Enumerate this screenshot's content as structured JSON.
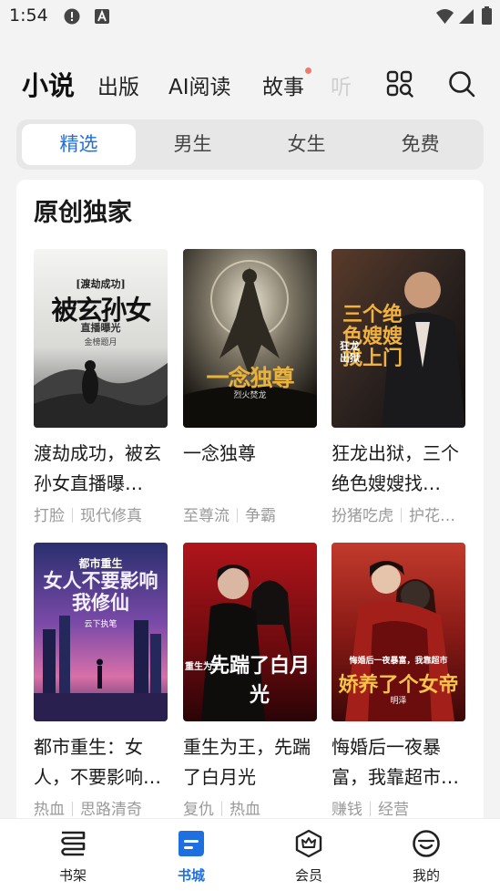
{
  "status": {
    "time": "1:54"
  },
  "top_nav": {
    "tabs": [
      {
        "label": "小说",
        "active": true
      },
      {
        "label": "出版"
      },
      {
        "label": "AI阅读"
      },
      {
        "label": "故事",
        "has_dot": true
      },
      {
        "label": "听"
      }
    ],
    "icons": [
      "category-icon",
      "search-icon"
    ]
  },
  "segment": {
    "items": [
      {
        "label": "精选",
        "active": true
      },
      {
        "label": "男生"
      },
      {
        "label": "女生"
      },
      {
        "label": "免费"
      }
    ]
  },
  "section": {
    "title": "原创独家",
    "books": [
      {
        "title": "渡劫成功，被玄孙女直播曝…",
        "tags": [
          "打脸",
          "现代修真"
        ],
        "cover_text": "被玄孙女",
        "cover_sub": "直播曝光",
        "cover_badge": "[渡劫成功]",
        "cover_author": "金榜题月"
      },
      {
        "title": "一念独尊",
        "tags": [
          "至尊流",
          "争霸"
        ],
        "cover_text": "一念独尊",
        "cover_author": "烈火焚龙"
      },
      {
        "title": "狂龙出狱，三个绝色嫂嫂找…",
        "tags": [
          "扮猪吃虎",
          "护花…"
        ],
        "cover_text": "三个绝色嫂嫂找上门",
        "cover_sub": "狂龙出狱"
      },
      {
        "title": "都市重生：女人，不要影响…",
        "tags": [
          "热血",
          "思路清奇"
        ],
        "cover_badge": "都市重生",
        "cover_text": "女人不要影响我修仙",
        "cover_author": "云下执笔"
      },
      {
        "title": "重生为王，先踹了白月光",
        "tags": [
          "复仇",
          "热血"
        ],
        "cover_text": "先踹了白月光",
        "cover_sub": "重生为王"
      },
      {
        "title": "悔婚后一夜暴富，我靠超市…",
        "tags": [
          "赚钱",
          "经营"
        ],
        "cover_text": "娇养了个女帝",
        "cover_sub": "悔婚后一夜暴富，我靠超市",
        "cover_author": "明泽"
      }
    ]
  },
  "bottom_bar": {
    "items": [
      {
        "label": "书架",
        "icon": "bookshelf-icon"
      },
      {
        "label": "书城",
        "icon": "bookstore-icon",
        "active": true
      },
      {
        "label": "会员",
        "icon": "vip-crown-icon"
      },
      {
        "label": "我的",
        "icon": "profile-smile-icon"
      }
    ]
  },
  "colors": {
    "accent": "#1e6fe0",
    "badge_dot": "#f07a6a",
    "muted": "#9a9a9a"
  }
}
